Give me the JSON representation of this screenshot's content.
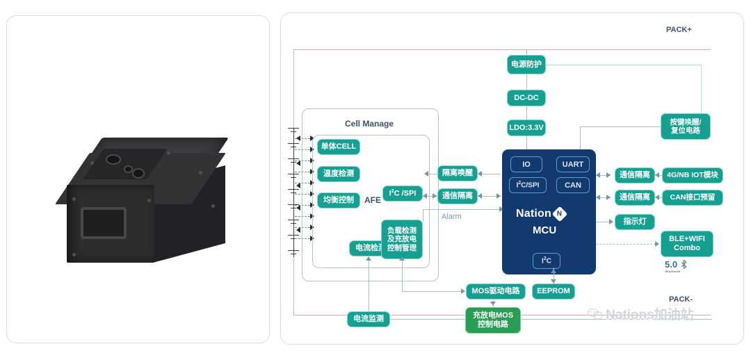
{
  "photo": {
    "alt_name": "battery-pack-photo",
    "description": "black lithium battery pack enclosure"
  },
  "diagram": {
    "title_labels": {
      "pack_plus": "PACK+",
      "pack_minus": "PACK-",
      "cell_manage": "Cell Manage",
      "afe": "AFE",
      "alarm": "Alarm"
    },
    "power_chain": [
      {
        "id": "power-protect",
        "label": "电源防护"
      },
      {
        "id": "dcdc",
        "label": "DC-DC"
      },
      {
        "id": "ldo",
        "label": "LDO:3.3V"
      }
    ],
    "cell_manage_blocks": [
      {
        "id": "single-cell",
        "label": "单体CELL"
      },
      {
        "id": "temp-detect",
        "label": "温度检测"
      },
      {
        "id": "balance-control",
        "label": "均衡控制"
      },
      {
        "id": "current-detect",
        "label": "电流检测"
      },
      {
        "id": "i2c-spi-afe",
        "label": "I²C /SPI"
      },
      {
        "id": "load-detect",
        "label": "负载检测\n及充放电\n控制管理"
      }
    ],
    "isolation_blocks": [
      {
        "id": "isolation-wake",
        "label": "隔离唤醒"
      },
      {
        "id": "comm-isolation-mid",
        "label": "通信隔离"
      }
    ],
    "mcu": {
      "brand": "Nation",
      "name": "MCU",
      "ports": [
        {
          "id": "io",
          "label": "IO"
        },
        {
          "id": "i2c-spi",
          "label": "I²C/SPI"
        },
        {
          "id": "uart",
          "label": "UART"
        },
        {
          "id": "can",
          "label": "CAN"
        },
        {
          "id": "i2c-bottom",
          "label": "I²C"
        }
      ]
    },
    "right_blocks": [
      {
        "id": "key-wake-reset",
        "label": "按键唤醒/\n复位电路"
      },
      {
        "id": "comm-isolation-1",
        "label": "通信隔离"
      },
      {
        "id": "iot-module",
        "label": "4G/NB IOT模块"
      },
      {
        "id": "comm-isolation-2",
        "label": "通信隔离"
      },
      {
        "id": "can-reserved",
        "label": "CAN接口预留"
      },
      {
        "id": "indicator-light",
        "label": "指示灯"
      },
      {
        "id": "ble-wifi",
        "label": "BLE+WIFI\nCombo"
      }
    ],
    "bluetooth_badge": {
      "version": "5.0",
      "name": "Bluetooth"
    },
    "bottom_blocks": [
      {
        "id": "mos-drive",
        "label": "MOS驱动电路"
      },
      {
        "id": "eeprom",
        "label": "EEPROM"
      },
      {
        "id": "current-monitor",
        "label": "电流监测"
      },
      {
        "id": "charge-discharge-mos",
        "label": "充放电MOS\n控制电路"
      }
    ]
  },
  "watermark": {
    "text": "Nations加油站",
    "icon": "wechat-icon"
  },
  "colors": {
    "teal": "#17a092",
    "green": "#2a9d55",
    "navy": "#123a6e",
    "line": "#aebcc8",
    "pack_line": "#e4a8a0"
  }
}
